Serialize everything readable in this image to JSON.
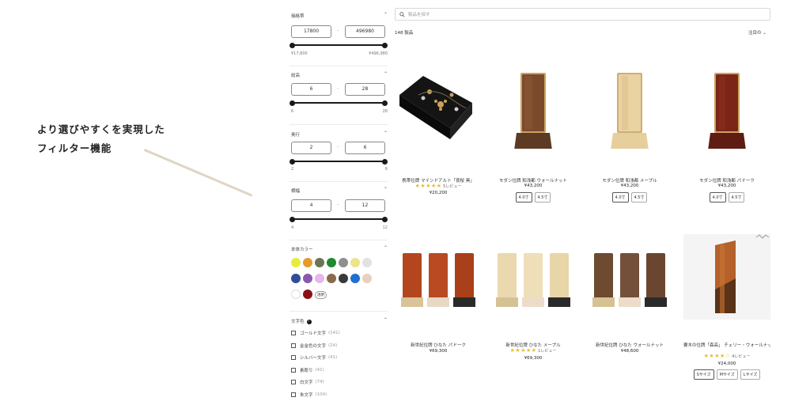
{
  "annotation": {
    "line1": "より選びやすくを実現した",
    "line2": "フィルター機能"
  },
  "search": {
    "placeholder": "製品を探す"
  },
  "results": {
    "count": "148 製品",
    "sort_label": "注目の"
  },
  "filters": {
    "price": {
      "title": "価格帯",
      "min": "17800",
      "max": "496980",
      "min_label": "¥17,800",
      "max_label": "¥496,980"
    },
    "height": {
      "title": "総高",
      "min": "6",
      "max": "28",
      "min_label": "6",
      "max_label": "28"
    },
    "depth": {
      "title": "奥行",
      "min": "2",
      "max": "6",
      "min_label": "2",
      "max_label": "6"
    },
    "width": {
      "title": "横幅",
      "min": "4",
      "max": "12",
      "min_label": "4",
      "max_label": "12"
    },
    "color": {
      "title": "本体カラー",
      "swatches": [
        "#e6ec3c",
        "#e59a2c",
        "#6b7551",
        "#1f8a2f",
        "#8f8f8f",
        "#ece48a",
        "#e2e2e2",
        "#2f4d9a",
        "#8a59ad",
        "#e7b6ea",
        "#8a6a4c",
        "#3a3a3a",
        "#1f6fd0",
        "#e8d0bc",
        "#ffffff",
        "#8a1116"
      ],
      "transparent_label": "透明"
    },
    "text_color": {
      "title": "文字色",
      "info_icon": "i",
      "options": [
        {
          "label": "ゴールド文字",
          "count": "(141)"
        },
        {
          "label": "金金色の文字",
          "count": "(24)"
        },
        {
          "label": "シルバー文字",
          "count": "(41)"
        },
        {
          "label": "素彫り",
          "count": "(41)"
        },
        {
          "label": "白文字",
          "count": "(74)"
        },
        {
          "label": "朱文字",
          "count": "(104)"
        }
      ]
    }
  },
  "products": [
    {
      "name": "携帯位牌 マインドアルト「夜桜 黒」",
      "stars": "★★★★★",
      "reviews": "5レビュー",
      "price": "¥20,200",
      "options": []
    },
    {
      "name": "モダン位牌 和浅都 ウォールナット",
      "stars": "",
      "reviews": "",
      "price": "¥43,200",
      "options": [
        "4.0寸",
        "4.5寸"
      ]
    },
    {
      "name": "モダン位牌 和浅都 メープル",
      "stars": "",
      "reviews": "",
      "price": "¥43,200",
      "options": [
        "4.0寸",
        "4.5寸"
      ]
    },
    {
      "name": "モダン位牌 和浅都 パドーク",
      "stars": "",
      "reviews": "",
      "price": "¥43,200",
      "options": [
        "4.0寸",
        "4.5寸"
      ]
    },
    {
      "name": "新世紀位牌 ひなた パドーク",
      "stars": "",
      "reviews": "",
      "price": "¥69,300",
      "options": []
    },
    {
      "name": "新世紀位牌 ひなた メープル",
      "stars": "★★★★★",
      "reviews": "1レビュー",
      "price": "¥69,300",
      "options": []
    },
    {
      "name": "新世紀位牌 ひなた ウォールナット",
      "stars": "",
      "reviews": "",
      "price": "¥48,600",
      "options": []
    },
    {
      "name": "要木の位牌「森高」 チェリー・ウォールナット",
      "stars": "★★★★☆",
      "reviews": "4レビュー",
      "price": "¥24,000",
      "options": [
        "Sサイズ",
        "Mサイズ",
        "Lサイズ"
      ]
    }
  ],
  "icon_names": {
    "search": "search-icon",
    "chevron": "chevron-up-icon",
    "sort_chevron": "chevron-down-icon"
  }
}
